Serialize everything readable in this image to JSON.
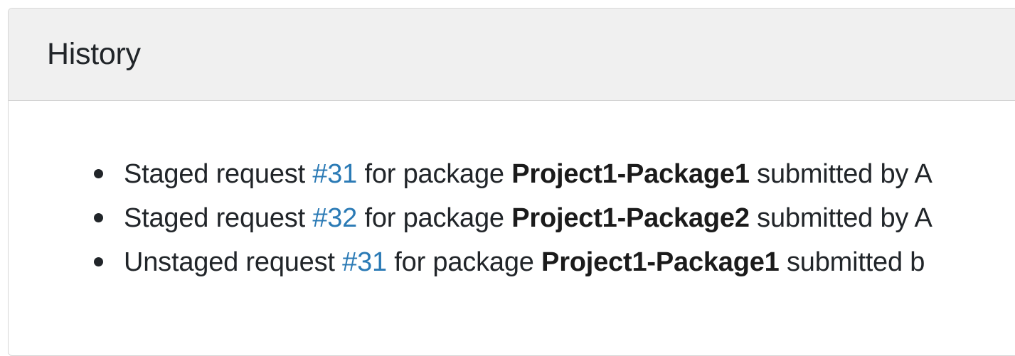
{
  "history": {
    "title": "History",
    "entries": [
      {
        "action": "Staged request ",
        "request_link": "#31",
        "for_text": " for package ",
        "package": "Project1-Package1",
        "submitted_text": " submitted by A"
      },
      {
        "action": "Staged request ",
        "request_link": "#32",
        "for_text": " for package ",
        "package": "Project1-Package2",
        "submitted_text": " submitted by A"
      },
      {
        "action": "Unstaged request ",
        "request_link": "#31",
        "for_text": " for package ",
        "package": "Project1-Package1",
        "submitted_text": " submitted b"
      }
    ]
  },
  "colors": {
    "link": "#2a7ab5",
    "header_bg": "#f0f0f0",
    "border": "#d7d7d7"
  }
}
